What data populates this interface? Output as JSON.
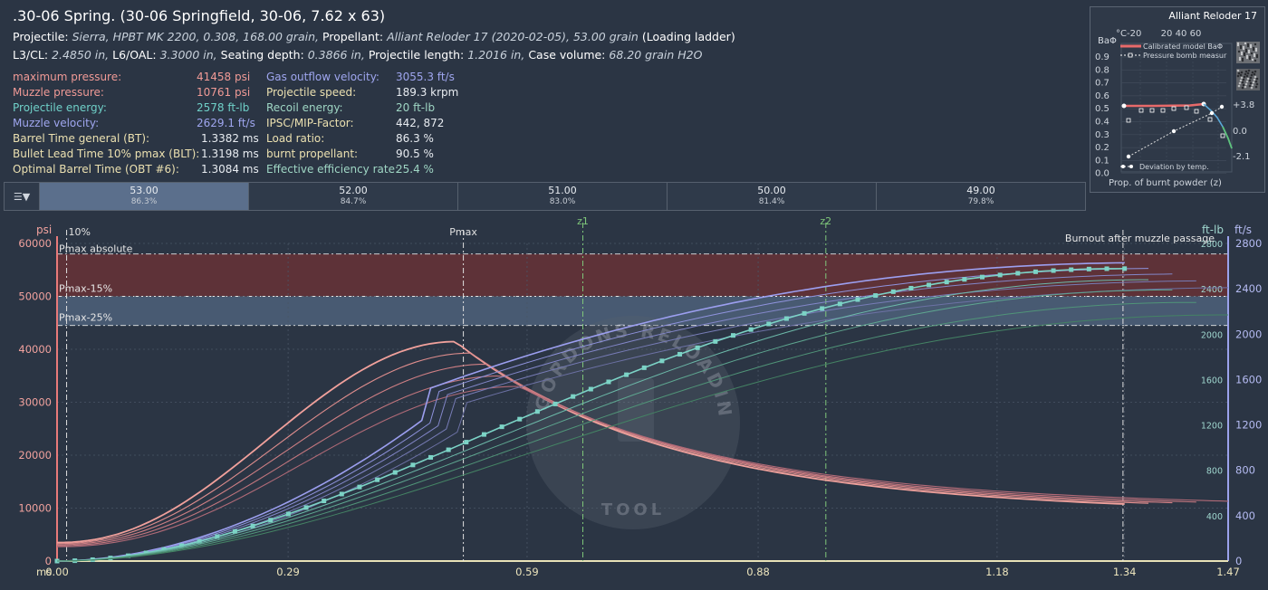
{
  "header": {
    "title": ".30-06 Spring. (30-06 Springfield, 30-06, 7.62 x 63)",
    "l2": {
      "projectile_label": "Projectile:",
      "projectile_value": "Sierra, HPBT MK 2200, 0.308, 168.00 grain,",
      "propellant_label": "Propellant:",
      "propellant_value": "Alliant Reloder 17 (2020-02-05), 53.00 grain",
      "propellant_note": "(Loading ladder)"
    },
    "l3": {
      "l3cl_label": "L3/CL:",
      "l3cl_value": "2.4850 in,",
      "l6_label": "L6/OAL:",
      "l6_value": "3.3000 in,",
      "seat_label": "Seating depth:",
      "seat_value": "0.3866 in,",
      "plen_label": "Projectile length:",
      "plen_value": "1.2016 in,",
      "case_label": "Case volume:",
      "case_value": "68.20 grain H2O"
    }
  },
  "stats_left": [
    {
      "label": "maximum pressure:",
      "value": "41458 psi",
      "color": "red"
    },
    {
      "label": "Muzzle pressure:",
      "value": "10761 psi",
      "color": "red"
    },
    {
      "label": "Projectile energy:",
      "value": "2578 ft-lb",
      "color": "teal"
    },
    {
      "label": "Muzzle velocity:",
      "value": "2629.1 ft/s",
      "color": "blue"
    },
    {
      "label": "Barrel Time general (BT):",
      "value": "1.3382 ms",
      "color": "yellow"
    },
    {
      "label": "Bullet Lead Time 10% pmax (BLT):",
      "value": "1.3198 ms",
      "color": "yellow"
    },
    {
      "label": "Optimal Barrel Time (OBT #6):",
      "value": "1.3084 ms",
      "color": "yellow"
    }
  ],
  "stats_right": [
    {
      "label": "Gas outflow velocity:",
      "value": "3055.3 ft/s",
      "color": "blue"
    },
    {
      "label": "Projectile speed:",
      "value": "189.3 krpm",
      "color": "yellow"
    },
    {
      "label": "Recoil energy:",
      "value": "20 ft-lb",
      "color": "green"
    },
    {
      "label": "IPSC/MIP-Factor:",
      "value": "442, 872",
      "color": "yellow"
    },
    {
      "label": "Load ratio:",
      "value": "86.3 %",
      "color": "yellow"
    },
    {
      "label": "burnt propellant:",
      "value": "90.5 %",
      "color": "yellow"
    },
    {
      "label": "Effective efficiency rate:",
      "value": "25.4 %",
      "color": "green"
    }
  ],
  "ladder": [
    {
      "charge": "53.00",
      "ratio": "86.3%"
    },
    {
      "charge": "52.00",
      "ratio": "84.7%"
    },
    {
      "charge": "51.00",
      "ratio": "83.0%"
    },
    {
      "charge": "50.00",
      "ratio": "81.4%"
    },
    {
      "charge": "49.00",
      "ratio": "79.8%"
    }
  ],
  "ladder_active_index": 0,
  "inset": {
    "title": "Alliant Reloder 17",
    "yleft_label": "BaΦ",
    "top_label": "°C-20",
    "xlabel": "Prop. of burnt powder (z)",
    "legend": [
      "Calibrated model BaΦ",
      "Pressure bomb measur"
    ],
    "note": "Deviation by temp.",
    "yleft_ticks": [
      "0.9",
      "0.8",
      "0.7",
      "0.6",
      "0.5",
      "0.4",
      "0.3",
      "0.2",
      "0.1",
      "0.0"
    ],
    "yright_ticks": [
      "+3.8",
      "0.0",
      "-2.1"
    ],
    "top_ticks": [
      "0",
      "20",
      "40",
      "60"
    ]
  },
  "bt_icon": "B/t",
  "watermark": [
    "GORDONS RELOADING",
    "TOOL"
  ],
  "chart_data": {
    "type": "line",
    "x_unit": "ms",
    "xlim": [
      0,
      1.47
    ],
    "x_ticks": [
      "0.00",
      "0.29",
      "0.59",
      "0.88",
      "1.18",
      "1.34",
      "1.47"
    ],
    "y_left_label": "psi",
    "y_left_lim": [
      0,
      60000
    ],
    "y_left_ticks": [
      "0",
      "10000",
      "20000",
      "30000",
      "40000",
      "50000",
      "60000"
    ],
    "y_right1_label": "ft-lb",
    "y_right1_lim": [
      0,
      2800
    ],
    "y_right1_ticks": [
      "400",
      "800",
      "1200",
      "1600",
      "2000",
      "2400",
      "2800"
    ],
    "y_right2_label": "ft/s",
    "y_right2_lim": [
      0,
      2800
    ],
    "y_right2_ticks": [
      "0",
      "400",
      "800",
      "1200",
      "1600",
      "2000",
      "2400",
      "2800"
    ],
    "bands": [
      {
        "name": "Pmax absolute",
        "from": 50000,
        "to": 58000,
        "color": "#5e3238"
      },
      {
        "name": "Pmax-15%",
        "from": 44500,
        "to": 50000,
        "color": "#485a72"
      },
      {
        "name": "Pmax-25%",
        "from": 44500,
        "to": 44500,
        "color": "#485a72"
      }
    ],
    "vlines": [
      {
        "label": "10%",
        "x": 0.012
      },
      {
        "label": "Pmax",
        "x": 0.51
      },
      {
        "label": "z1",
        "x": 0.66
      },
      {
        "label": "z2",
        "x": 0.965
      },
      {
        "label": "",
        "x": 1.338
      }
    ],
    "burnout_label": "Burnout after muzzle passage",
    "pressure_series": [
      {
        "charge": 53,
        "pmax": 41458,
        "tpeak": 0.5,
        "pmuzzle": 10761,
        "tend": 1.34
      },
      {
        "charge": 52,
        "pmax": 39300,
        "tpeak": 0.52,
        "pmuzzle": 10900,
        "tend": 1.37
      },
      {
        "charge": 51,
        "pmax": 37200,
        "tpeak": 0.54,
        "pmuzzle": 11000,
        "tend": 1.4
      },
      {
        "charge": 50,
        "pmax": 35000,
        "tpeak": 0.56,
        "pmuzzle": 11150,
        "tend": 1.43
      },
      {
        "charge": 49,
        "pmax": 33000,
        "tpeak": 0.58,
        "pmuzzle": 11300,
        "tend": 1.47
      }
    ],
    "velocity_series": [
      {
        "charge": 53,
        "muzzle_velocity": 2629.1,
        "tend": 1.34
      },
      {
        "charge": 52,
        "muzzle_velocity": 2580,
        "tend": 1.37
      },
      {
        "charge": 51,
        "muzzle_velocity": 2530,
        "tend": 1.4
      },
      {
        "charge": 50,
        "muzzle_velocity": 2470,
        "tend": 1.43
      },
      {
        "charge": 49,
        "muzzle_velocity": 2410,
        "tend": 1.47
      }
    ],
    "energy_series": [
      {
        "charge": 53,
        "muzzle_energy": 2578,
        "tend": 1.34
      },
      {
        "charge": 52,
        "muzzle_energy": 2480,
        "tend": 1.37
      },
      {
        "charge": 51,
        "muzzle_energy": 2390,
        "tend": 1.4
      },
      {
        "charge": 50,
        "muzzle_energy": 2280,
        "tend": 1.43
      },
      {
        "charge": 49,
        "muzzle_energy": 2170,
        "tend": 1.47
      }
    ]
  }
}
